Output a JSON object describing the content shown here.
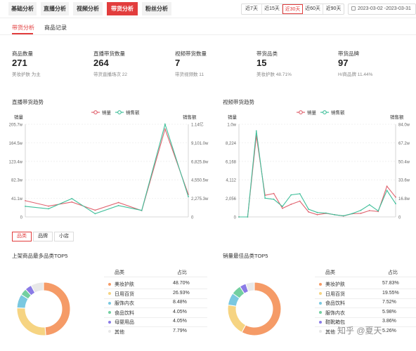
{
  "main_tabs": [
    {
      "label": "基础分析",
      "active": false
    },
    {
      "label": "直播分析",
      "active": false
    },
    {
      "label": "视频分析",
      "active": false
    },
    {
      "label": "带货分析",
      "active": true
    },
    {
      "label": "粉丝分析",
      "active": false
    }
  ],
  "date_range": {
    "options": [
      {
        "label": "近7天",
        "active": false
      },
      {
        "label": "近15天",
        "active": false
      },
      {
        "label": "近30天",
        "active": true
      },
      {
        "label": "近60天",
        "active": false
      },
      {
        "label": "近90天",
        "active": false
      }
    ],
    "value": "2023-03-02  -2023-03-31"
  },
  "sub_tabs": [
    {
      "label": "带货分析",
      "active": true
    },
    {
      "label": "商品记录",
      "active": false
    }
  ],
  "stats": [
    {
      "label": "商品数量",
      "value": "271",
      "sub": "美妆护肤 为主"
    },
    {
      "label": "直播带货数量",
      "value": "264",
      "sub": "带货直播场次 22"
    },
    {
      "label": "视频带货数量",
      "value": "7",
      "sub": "带货视频数 11"
    },
    {
      "label": "带货品类",
      "value": "15",
      "sub": "美妆护肤 48.71%"
    },
    {
      "label": "带货品牌",
      "value": "97",
      "sub": "H/商品牌 11.44%"
    }
  ],
  "chart_data": [
    {
      "type": "line",
      "title": "直播带货趋势",
      "legend": [
        "销量",
        "销售额"
      ],
      "legend_position": "top-center",
      "y_left_label": "销量",
      "y_right_label": "销售额",
      "y_left_ticks": [
        "205.7w",
        "164.5w",
        "123.4w",
        "82.3w",
        "41.1w",
        "0"
      ],
      "y_right_ticks": [
        "1.14亿",
        "9,101.0w",
        "6,825.8w",
        "4,550.5w",
        "2,275.3w",
        "0"
      ],
      "y_left_lim": [
        0,
        2057000
      ],
      "y_right_lim": [
        0,
        114000000
      ],
      "grid": true,
      "series": [
        {
          "name": "销量",
          "color": "#e0626e",
          "values": [
            360000,
            240000,
            330000,
            150000,
            320000,
            140000,
            1950000,
            500000
          ]
        },
        {
          "name": "销售额",
          "color": "#3fbf9a",
          "values": [
            13000000,
            10000000,
            22500000,
            4000000,
            14000000,
            8000000,
            114000000,
            25000000
          ]
        }
      ]
    },
    {
      "type": "line",
      "title": "视频带货趋势",
      "legend": [
        "销量",
        "销售额"
      ],
      "legend_position": "top-center",
      "y_left_label": "销量",
      "y_right_label": "销售额",
      "y_left_ticks": [
        "1.0w",
        "8,224",
        "6,168",
        "4,112",
        "2,056",
        "0"
      ],
      "y_right_ticks": [
        "84.0w",
        "67.2w",
        "50.4w",
        "33.6w",
        "16.8w",
        "0"
      ],
      "y_left_lim": [
        0,
        10280
      ],
      "y_right_lim": [
        0,
        840000
      ],
      "grid": true,
      "series": [
        {
          "name": "销量",
          "color": "#e0626e",
          "values": [
            0,
            0,
            9000,
            2400,
            2600,
            950,
            1400,
            1750,
            550,
            250,
            400,
            250,
            100,
            350,
            400,
            700,
            600,
            3400,
            2200
          ]
        },
        {
          "name": "销售额",
          "color": "#3fbf9a",
          "values": [
            0,
            0,
            780000,
            170000,
            160000,
            95000,
            200000,
            210000,
            70000,
            40000,
            35000,
            20000,
            10000,
            30000,
            60000,
            110000,
            55000,
            240000,
            120000
          ]
        }
      ]
    },
    {
      "type": "pie",
      "title": "上架商品最多品类TOP5",
      "header": {
        "category": "品类",
        "share": "占比"
      },
      "slices": [
        {
          "label": "美妆护肤",
          "value": 48.7,
          "display": "48.70%",
          "color": "#f59b67"
        },
        {
          "label": "日用百货",
          "value": 26.93,
          "display": "26.93%",
          "color": "#f6d482"
        },
        {
          "label": "服饰内衣",
          "value": 8.48,
          "display": "8.48%",
          "color": "#7ac8e0"
        },
        {
          "label": "食品饮料",
          "value": 4.05,
          "display": "4.05%",
          "color": "#73cfa0"
        },
        {
          "label": "母婴用品",
          "value": 4.05,
          "display": "4.05%",
          "color": "#8a7be6"
        },
        {
          "label": "其他",
          "value": 7.79,
          "display": "7.79%",
          "color": "#e8e8e8"
        }
      ]
    },
    {
      "type": "pie",
      "title": "销量最佳品类TOP5",
      "header": {
        "category": "品类",
        "share": "占比"
      },
      "slices": [
        {
          "label": "美妆护肤",
          "value": 57.83,
          "display": "57.83%",
          "color": "#f59b67"
        },
        {
          "label": "日用百货",
          "value": 19.55,
          "display": "19.55%",
          "color": "#f6d482"
        },
        {
          "label": "食品饮料",
          "value": 7.52,
          "display": "7.52%",
          "color": "#7ac8e0"
        },
        {
          "label": "服饰内衣",
          "value": 5.98,
          "display": "5.98%",
          "color": "#73cfa0"
        },
        {
          "label": "鞋靴箱包",
          "value": 3.86,
          "display": "3.86%",
          "color": "#8a7be6"
        },
        {
          "label": "其他",
          "value": 5.26,
          "display": "5.26%",
          "color": "#e8e8e8"
        }
      ]
    }
  ],
  "category_toggles": [
    {
      "label": "品类",
      "active": true
    },
    {
      "label": "品牌",
      "active": false
    },
    {
      "label": "小店",
      "active": false
    }
  ],
  "watermark": "知乎 @夏天"
}
